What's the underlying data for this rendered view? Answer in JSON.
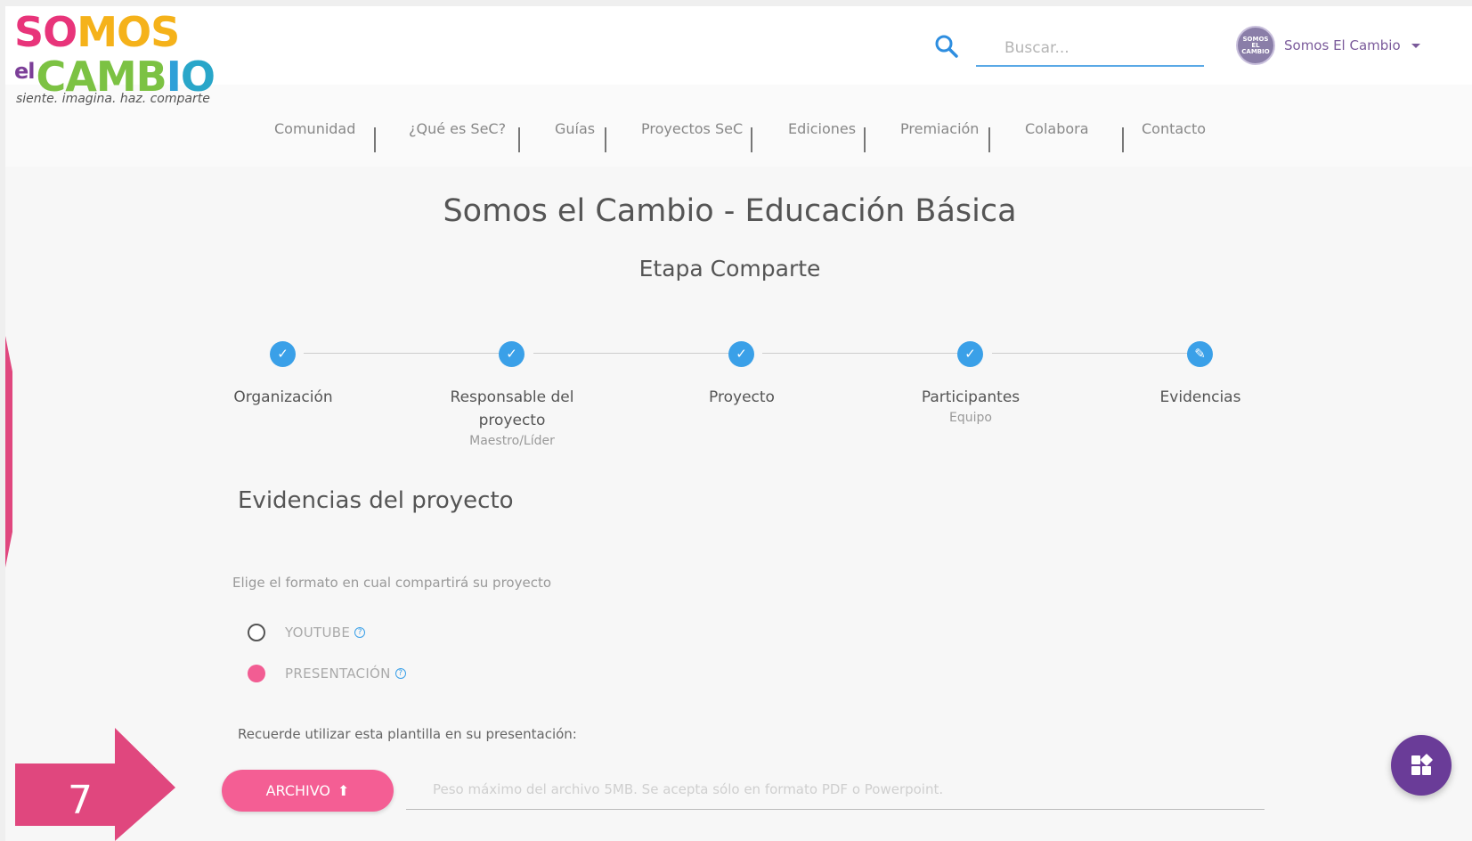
{
  "brand": {
    "word1": [
      "S",
      "O",
      "M",
      "O",
      "S"
    ],
    "el": "el",
    "word2": [
      "C",
      "A",
      "M",
      "B",
      "I",
      "O"
    ],
    "tagline": "siente. imagina. haz. comparte"
  },
  "search": {
    "placeholder": "Buscar..."
  },
  "user": {
    "name": "Somos El Cambio",
    "avatar_text": "SOMOS EL CAMBIO"
  },
  "nav": [
    "Comunidad",
    "¿Qué es SeC?",
    "Guías",
    "Proyectos SeC",
    "Ediciones",
    "Premiación",
    "Colabora",
    "Contacto"
  ],
  "page": {
    "title": "Somos el Cambio - Educación Básica",
    "subtitle": "Etapa Comparte"
  },
  "steps": [
    {
      "label": "Organización",
      "sub": "",
      "state": "done"
    },
    {
      "label": "Responsable del proyecto",
      "sub": "Maestro/Líder",
      "state": "done"
    },
    {
      "label": "Proyecto",
      "sub": "",
      "state": "done"
    },
    {
      "label": "Participantes",
      "sub": "Equipo",
      "state": "done"
    },
    {
      "label": "Evidencias",
      "sub": "",
      "state": "editing"
    }
  ],
  "form": {
    "section_title": "Evidencias del proyecto",
    "format_hint": "Elige el formato en cual compartirá su proyecto",
    "options": [
      {
        "label": "YOUTUBE",
        "selected": false
      },
      {
        "label": "PRESENTACIÓN",
        "selected": true
      }
    ],
    "reminder": "Recuerde utilizar esta plantilla en su presentación:",
    "upload_button": "ARCHIVO",
    "upload_placeholder": "Peso máximo del archivo 5MB. Se acepta sólo en formato PDF o Powerpoint."
  },
  "annotation": {
    "step_number": "7"
  },
  "colors": {
    "accent_blue": "#3aa0e8",
    "accent_pink": "#f45e94",
    "brand_purple": "#6a3c98",
    "arrow": "#e0477e"
  }
}
